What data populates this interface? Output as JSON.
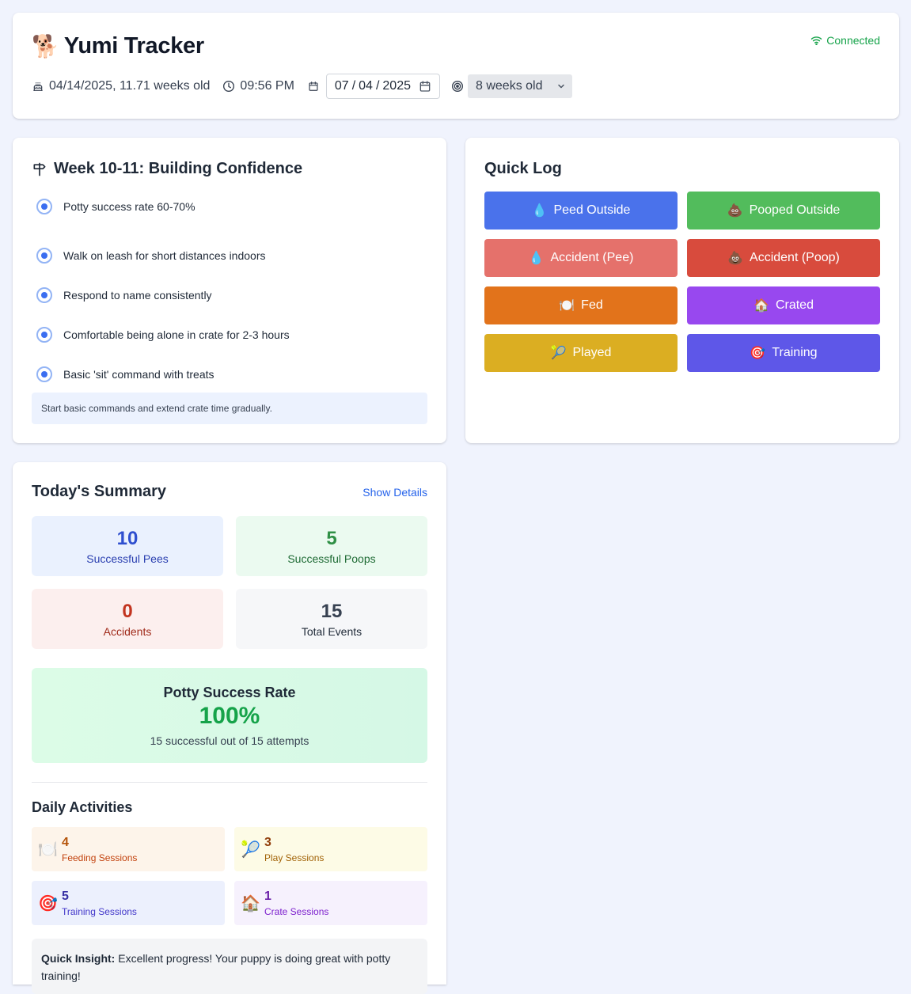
{
  "header": {
    "logo_icon": "dog-emoji",
    "logo_glyph": "🐕",
    "title": "Yumi Tracker",
    "connection": "Connected",
    "birthday_text": "04/14/2025, 11.71 weeks old",
    "time_text": "09:56 PM",
    "date_value": {
      "month": "07",
      "day": "04",
      "year": "2025"
    },
    "date_sep": "/",
    "age_select": "8 weeks old"
  },
  "milestones": {
    "title": "Week 10-11: Building Confidence",
    "items": [
      "Potty success rate 60-70%",
      "Walk on leash for short distances indoors",
      "Respond to name consistently",
      "Comfortable being alone in crate for 2-3 hours",
      "Basic 'sit' command with treats"
    ],
    "tip": "Start basic commands and extend crate time gradually."
  },
  "quick_log": {
    "title": "Quick Log",
    "buttons": [
      {
        "emoji": "💧",
        "label": "Peed Outside",
        "color": "#4a72eb"
      },
      {
        "emoji": "💩",
        "label": "Pooped Outside",
        "color": "#52bc5c"
      },
      {
        "emoji": "💧",
        "label": "Accident (Pee)",
        "color": "#e5716b"
      },
      {
        "emoji": "💩",
        "label": "Accident (Poop)",
        "color": "#d84b3d"
      },
      {
        "emoji": "🍽️",
        "label": "Fed",
        "color": "#e2731b"
      },
      {
        "emoji": "🏠",
        "label": "Crated",
        "color": "#9848ef"
      },
      {
        "emoji": "🎾",
        "label": "Played",
        "color": "#dbae22"
      },
      {
        "emoji": "🎯",
        "label": "Training",
        "color": "#5e57e8"
      }
    ]
  },
  "summary": {
    "title": "Today's Summary",
    "details_link": "Show Details",
    "stats": [
      {
        "value": "10",
        "label": "Successful Pees"
      },
      {
        "value": "5",
        "label": "Successful Poops"
      },
      {
        "value": "0",
        "label": "Accidents"
      },
      {
        "value": "15",
        "label": "Total Events"
      }
    ],
    "success": {
      "title": "Potty Success Rate",
      "percent": "100%",
      "subtitle": "15 successful out of 15 attempts"
    },
    "activities_title": "Daily Activities",
    "activities": [
      {
        "emoji": "🍽️",
        "value": "4",
        "label": "Feeding Sessions"
      },
      {
        "emoji": "🎾",
        "value": "3",
        "label": "Play Sessions"
      },
      {
        "emoji": "🎯",
        "value": "5",
        "label": "Training Sessions"
      },
      {
        "emoji": "🏠",
        "value": "1",
        "label": "Crate Sessions"
      }
    ],
    "insight_label": "Quick Insight:",
    "insight_text": "Excellent progress! Your puppy is doing great with potty training!"
  }
}
